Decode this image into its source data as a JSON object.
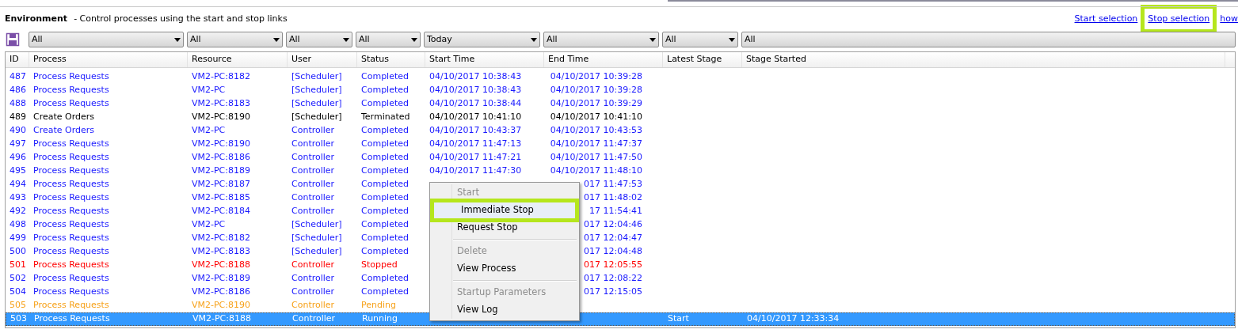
{
  "header": {
    "title": "Environment",
    "subtitle": "- Control processes using the start and stop links"
  },
  "links": [
    {
      "label": "Start selection",
      "highlighted": false
    },
    {
      "label": "Stop selection",
      "highlighted": true
    },
    {
      "label": "how",
      "highlighted": false
    }
  ],
  "filters": [
    "All",
    "All",
    "All",
    "All",
    "Today",
    "All",
    "All",
    "All"
  ],
  "table": {
    "columns": [
      "ID",
      "Process",
      "Resource",
      "User",
      "Status",
      "Start Time",
      "End Time",
      "Latest Stage",
      "Stage Started"
    ],
    "rows": [
      {
        "cells": [
          "487",
          "Process Requests",
          "VM2-PC:8182",
          "[Scheduler]",
          "Completed",
          "04/10/2017 10:38:43",
          "04/10/2017 10:39:28"
        ],
        "color": "#1a1aff",
        "selected": false
      },
      {
        "cells": [
          "486",
          "Process Requests",
          "VM2-PC",
          "[Scheduler]",
          "Completed",
          "04/10/2017 10:38:43",
          "04/10/2017 10:39:28"
        ],
        "color": "#1a1aff",
        "selected": false
      },
      {
        "cells": [
          "488",
          "Process Requests",
          "VM2-PC:8183",
          "[Scheduler]",
          "Completed",
          "04/10/2017 10:38:44",
          "04/10/2017 10:39:29"
        ],
        "color": "#1a1aff",
        "selected": false
      },
      {
        "cells": [
          "489",
          "Create Orders",
          "VM2-PC:8190",
          "[Scheduler]",
          "Terminated",
          "04/10/2017 10:41:10",
          "04/10/2017 10:41:10"
        ],
        "color": "#000000",
        "selected": false
      },
      {
        "cells": [
          "490",
          "Create Orders",
          "VM2-PC",
          "Controller",
          "Completed",
          "04/10/2017 10:43:37",
          "04/10/2017 10:43:53"
        ],
        "color": "#1a1aff",
        "selected": false
      },
      {
        "cells": [
          "497",
          "Process Requests",
          "VM2-PC:8190",
          "Controller",
          "Completed",
          "04/10/2017 11:47:13",
          "04/10/2017 11:47:37"
        ],
        "color": "#1a1aff",
        "selected": false
      },
      {
        "cells": [
          "496",
          "Process Requests",
          "VM2-PC:8186",
          "Controller",
          "Completed",
          "04/10/2017 11:47:21",
          "04/10/2017 11:47:50"
        ],
        "color": "#1a1aff",
        "selected": false
      },
      {
        "cells": [
          "495",
          "Process Requests",
          "VM2-PC:8189",
          "Controller",
          "Completed",
          "04/10/2017 11:47:30",
          "04/10/2017 11:48:10"
        ],
        "color": "#1a1aff",
        "selected": false
      },
      {
        "cells": [
          "494",
          "Process Requests",
          "VM2-PC:8187",
          "Controller",
          "Completed",
          "",
          "017 11:47:53"
        ],
        "color": "#1a1aff",
        "selected": false
      },
      {
        "cells": [
          "493",
          "Process Requests",
          "VM2-PC:8185",
          "Controller",
          "Completed",
          "",
          "017 11:48:02"
        ],
        "color": "#1a1aff",
        "selected": false
      },
      {
        "cells": [
          "492",
          "Process Requests",
          "VM2-PC:8184",
          "Controller",
          "Completed",
          "",
          "17 11:54:41"
        ],
        "color": "#1a1aff",
        "selected": false
      },
      {
        "cells": [
          "498",
          "Process Requests",
          "VM2-PC",
          "[Scheduler]",
          "Completed",
          "",
          "017 12:04:46"
        ],
        "color": "#1a1aff",
        "selected": false
      },
      {
        "cells": [
          "499",
          "Process Requests",
          "VM2-PC:8182",
          "[Scheduler]",
          "Completed",
          "",
          "017 12:04:47"
        ],
        "color": "#1a1aff",
        "selected": false
      },
      {
        "cells": [
          "500",
          "Process Requests",
          "VM2-PC:8183",
          "[Scheduler]",
          "Completed",
          "",
          "017 12:04:48"
        ],
        "color": "#1a1aff",
        "selected": false
      },
      {
        "cells": [
          "501",
          "Process Requests",
          "VM2-PC:8188",
          "Controller",
          "Stopped",
          "",
          "017 12:05:55"
        ],
        "color": "#ff0000",
        "selected": false
      },
      {
        "cells": [
          "502",
          "Process Requests",
          "VM2-PC:8189",
          "Controller",
          "Completed",
          "",
          "017 12:08:22"
        ],
        "color": "#1a1aff",
        "selected": false
      },
      {
        "cells": [
          "504",
          "Process Requests",
          "VM2-PC:8186",
          "Controller",
          "Completed",
          "",
          "017 12:15:05"
        ],
        "color": "#1a1aff",
        "selected": false
      },
      {
        "cells": [
          "505",
          "Process Requests",
          "VM2-PC:8190",
          "Controller",
          "Pending"
        ],
        "color": "#f7a21b",
        "selected": false
      },
      {
        "cells": [
          "503",
          "Process Requests",
          "VM2-PC:8188",
          "Controller",
          "Running",
          "",
          "",
          "Start",
          "04/10/2017 12:33:34"
        ],
        "color": "#ffffff",
        "selected": true
      }
    ]
  },
  "context_menu": [
    {
      "label": "Start",
      "disabled": true,
      "hovered": false
    },
    {
      "label": "Immediate Stop",
      "disabled": false,
      "hovered": true
    },
    {
      "label": "Request Stop",
      "disabled": false,
      "hovered": false
    },
    {
      "kind": "separator"
    },
    {
      "label": "Delete",
      "disabled": true,
      "hovered": false
    },
    {
      "label": "View Process",
      "disabled": false,
      "hovered": false
    },
    {
      "kind": "separator"
    },
    {
      "label": "Startup Parameters",
      "disabled": true,
      "hovered": false
    },
    {
      "label": "View Log",
      "disabled": false,
      "hovered": false
    }
  ]
}
